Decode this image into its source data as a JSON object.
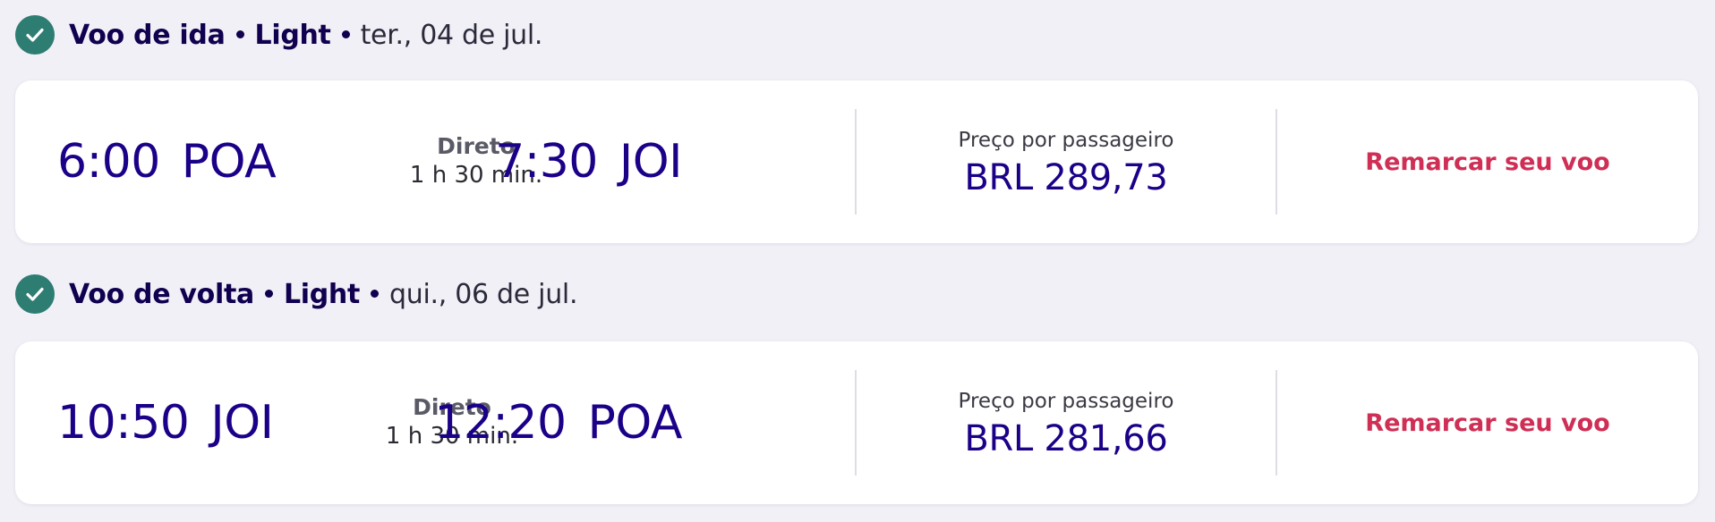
{
  "outbound": {
    "direction_label": "Voo de ida",
    "fare_label": "Light",
    "date": "ter., 04 de jul.",
    "departure_time": "6:00",
    "departure_airport": "POA",
    "stops_label": "Direto",
    "duration": "1 h 30 min.",
    "arrival_time": "7:30",
    "arrival_airport": "JOI",
    "price_label": "Preço por passageiro",
    "price": "BRL 289,73",
    "rebook_label": "Remarcar seu voo"
  },
  "return": {
    "direction_label": "Voo de volta",
    "fare_label": "Light",
    "date": "qui., 06 de jul.",
    "departure_time": "10:50",
    "departure_airport": "JOI",
    "stops_label": "Direto",
    "duration": "1 h 30 min.",
    "arrival_time": "12:20",
    "arrival_airport": "POA",
    "price_label": "Preço por passageiro",
    "price": "BRL 281,66",
    "rebook_label": "Remarcar seu voo"
  },
  "icons": {
    "confirmed": "check-circle-icon"
  },
  "colors": {
    "primary": "#1b0088",
    "accent": "#cf2e55",
    "confirmed": "#2e7d72",
    "background": "#f1f0f6"
  }
}
